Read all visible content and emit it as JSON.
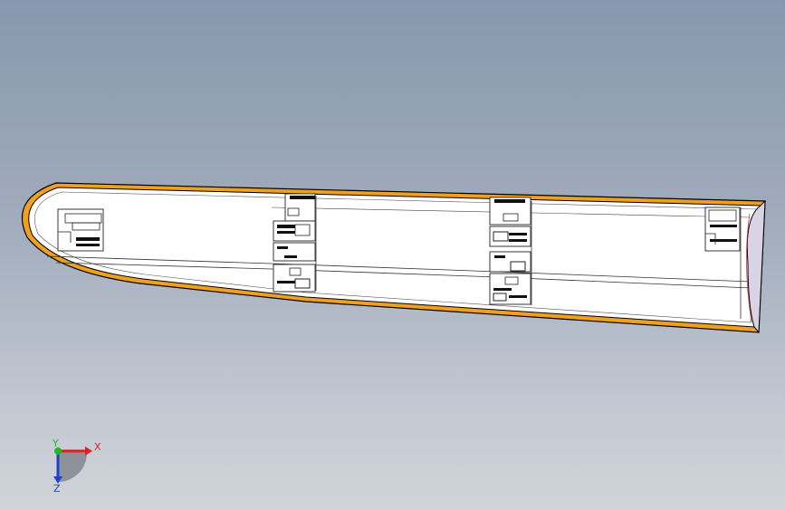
{
  "triad": {
    "x_label": "X",
    "y_label": "Y",
    "z_label": "Z",
    "x_color": "#e02020",
    "y_color": "#22b822",
    "z_color": "#2040d0"
  },
  "colors": {
    "background_top": "#8797ad",
    "background_bottom": "#d1d4da",
    "part_fill": "#ffffff",
    "flange_edge": "#f0a020",
    "outline": "#000000",
    "end_cap": "#d8d4e6"
  },
  "icons": {
    "triad": "coordinate-triad-icon"
  }
}
